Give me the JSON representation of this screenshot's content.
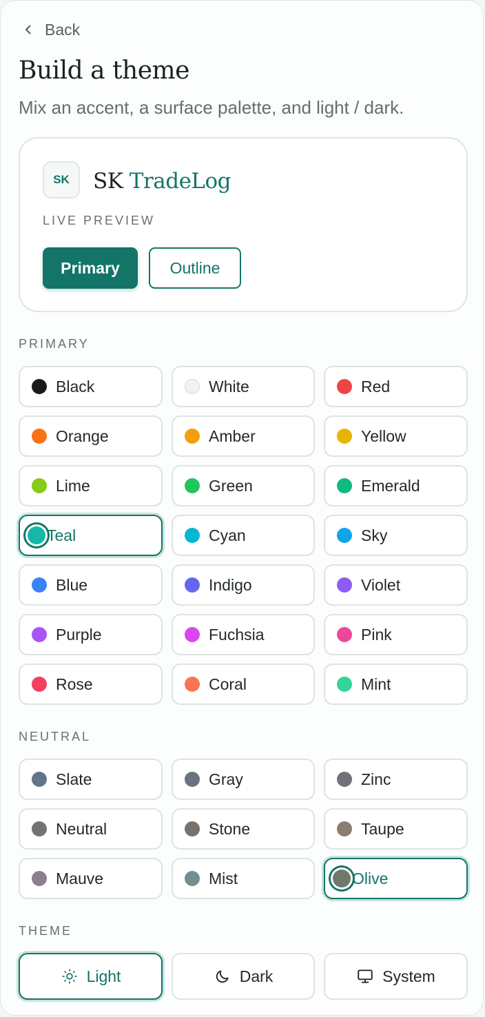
{
  "nav": {
    "back_label": "Back"
  },
  "header": {
    "title": "Build a theme",
    "subtitle": "Mix an accent, a surface palette, and light / dark."
  },
  "preview": {
    "logo_initials": "SK",
    "brand_part1": "SK",
    "brand_part2": "TradeLog",
    "label": "LIVE PREVIEW",
    "primary_button": "Primary",
    "outline_button": "Outline"
  },
  "primary_section": {
    "label": "PRIMARY",
    "selected": "Teal",
    "options": [
      {
        "name": "Black",
        "color": "#1a1a1a"
      },
      {
        "name": "White",
        "color": "#f2f2f2"
      },
      {
        "name": "Red",
        "color": "#ef4444"
      },
      {
        "name": "Orange",
        "color": "#f97316"
      },
      {
        "name": "Amber",
        "color": "#f59e0b"
      },
      {
        "name": "Yellow",
        "color": "#eab308"
      },
      {
        "name": "Lime",
        "color": "#84cc16"
      },
      {
        "name": "Green",
        "color": "#22c55e"
      },
      {
        "name": "Emerald",
        "color": "#10b981"
      },
      {
        "name": "Teal",
        "color": "#14b8a6"
      },
      {
        "name": "Cyan",
        "color": "#06b6d4"
      },
      {
        "name": "Sky",
        "color": "#0ea5e9"
      },
      {
        "name": "Blue",
        "color": "#3b82f6"
      },
      {
        "name": "Indigo",
        "color": "#6366f1"
      },
      {
        "name": "Violet",
        "color": "#8b5cf6"
      },
      {
        "name": "Purple",
        "color": "#a855f7"
      },
      {
        "name": "Fuchsia",
        "color": "#d946ef"
      },
      {
        "name": "Pink",
        "color": "#ec4899"
      },
      {
        "name": "Rose",
        "color": "#f43f5e"
      },
      {
        "name": "Coral",
        "color": "#f97354"
      },
      {
        "name": "Mint",
        "color": "#34d399"
      }
    ]
  },
  "neutral_section": {
    "label": "NEUTRAL",
    "selected": "Olive",
    "options": [
      {
        "name": "Slate",
        "color": "#64748b"
      },
      {
        "name": "Gray",
        "color": "#6b7280"
      },
      {
        "name": "Zinc",
        "color": "#71717a"
      },
      {
        "name": "Neutral",
        "color": "#737373"
      },
      {
        "name": "Stone",
        "color": "#78716c"
      },
      {
        "name": "Taupe",
        "color": "#8b7d70"
      },
      {
        "name": "Mauve",
        "color": "#8a7f8c"
      },
      {
        "name": "Mist",
        "color": "#6f8f90"
      },
      {
        "name": "Olive",
        "color": "#6f786a"
      }
    ]
  },
  "theme_section": {
    "label": "THEME",
    "selected": "Light",
    "options": [
      {
        "name": "Light",
        "icon": "sun-icon"
      },
      {
        "name": "Dark",
        "icon": "moon-icon"
      },
      {
        "name": "System",
        "icon": "monitor-icon"
      }
    ]
  },
  "colors": {
    "accent": "#127567",
    "accent_ring": "#c7e4de",
    "border": "#dde4e2",
    "text": "#222a27",
    "muted_text": "#67716d"
  }
}
